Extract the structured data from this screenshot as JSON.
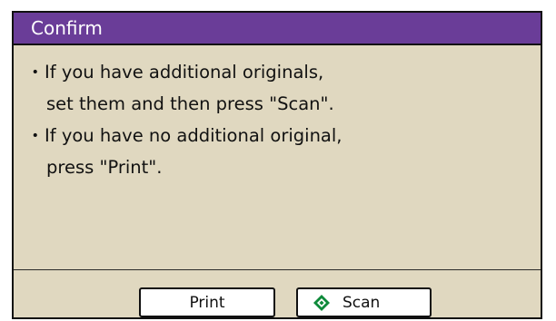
{
  "dialog": {
    "title": "Confirm",
    "bullet_glyph": "・",
    "messages": [
      {
        "line1": "If you have additional originals,",
        "line2": "set them and then press \"Scan\"."
      },
      {
        "line1": "If you have no additional original,",
        "line2": "press \"Print\"."
      }
    ],
    "buttons": {
      "print_label": "Print",
      "scan_label": "Scan",
      "scan_icon": "start-diamond-icon"
    }
  },
  "colors": {
    "title_bar": "#6a3d98",
    "panel_background": "#e0d8c0",
    "start_icon_green": "#0e8a3a"
  }
}
